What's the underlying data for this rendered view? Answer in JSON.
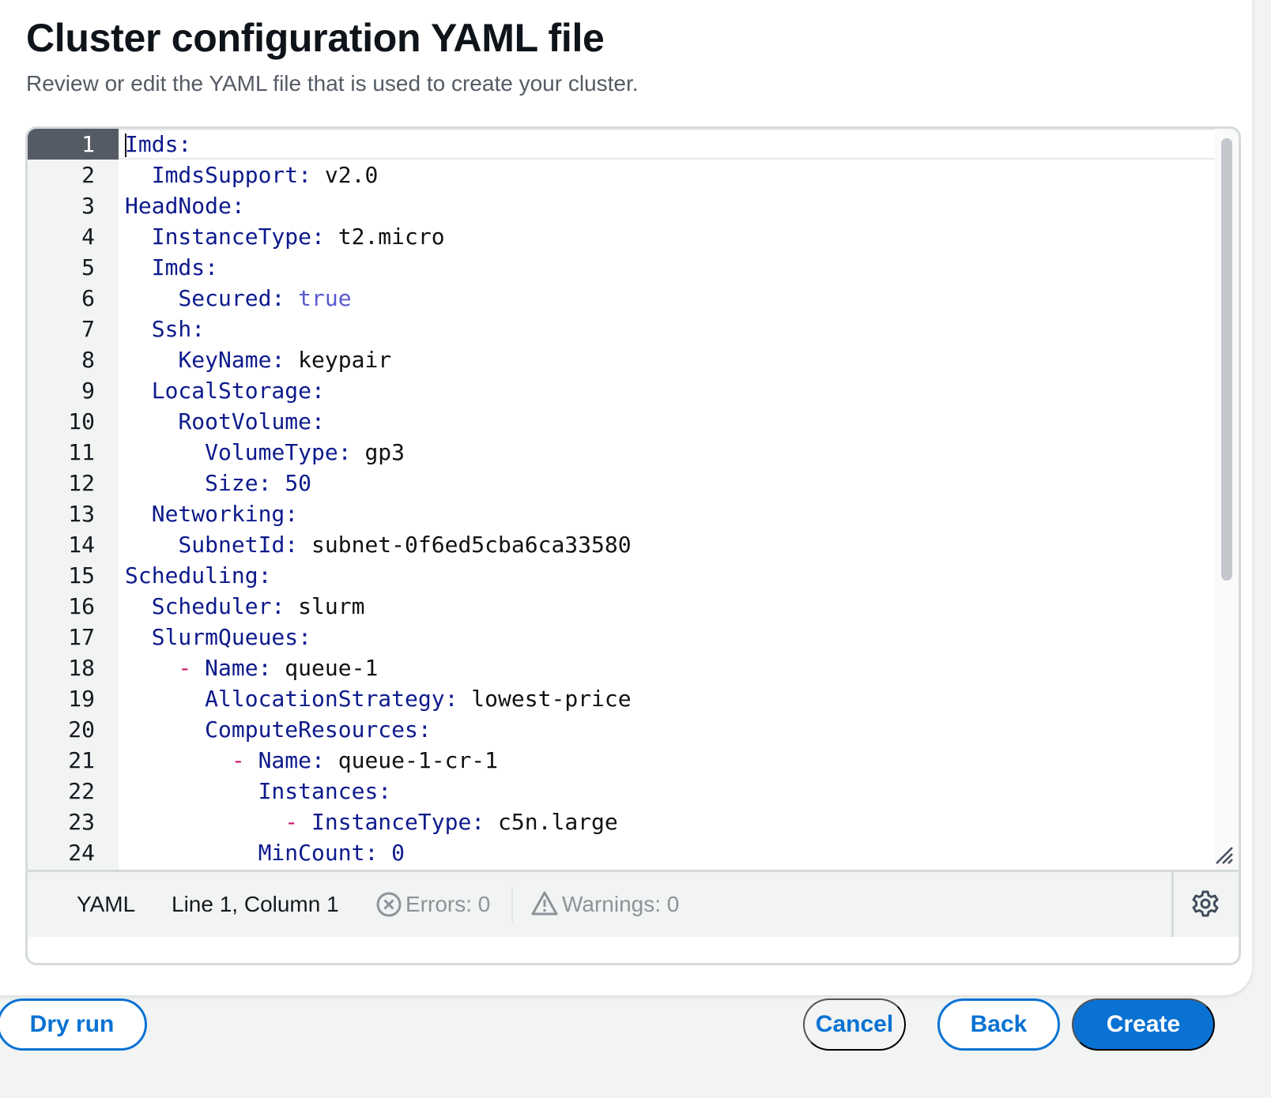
{
  "page": {
    "title": "Cluster configuration YAML file",
    "subtitle": "Review or edit the YAML file that is used to create your cluster."
  },
  "editor": {
    "line_numbers": [
      "1",
      "2",
      "3",
      "4",
      "5",
      "6",
      "7",
      "8",
      "9",
      "10",
      "11",
      "12",
      "13",
      "14",
      "15",
      "16",
      "17",
      "18",
      "19",
      "20",
      "21",
      "22",
      "23",
      "24"
    ],
    "lines": [
      [
        {
          "t": "k",
          "s": "Imds:"
        }
      ],
      [
        {
          "t": "v",
          "s": "  "
        },
        {
          "t": "k",
          "s": "ImdsSupport:"
        },
        {
          "t": "v",
          "s": " v2.0"
        }
      ],
      [
        {
          "t": "k",
          "s": "HeadNode:"
        }
      ],
      [
        {
          "t": "v",
          "s": "  "
        },
        {
          "t": "k",
          "s": "InstanceType:"
        },
        {
          "t": "v",
          "s": " t2.micro"
        }
      ],
      [
        {
          "t": "v",
          "s": "  "
        },
        {
          "t": "k",
          "s": "Imds:"
        }
      ],
      [
        {
          "t": "v",
          "s": "    "
        },
        {
          "t": "k",
          "s": "Secured:"
        },
        {
          "t": "v",
          "s": " "
        },
        {
          "t": "b",
          "s": "true"
        }
      ],
      [
        {
          "t": "v",
          "s": "  "
        },
        {
          "t": "k",
          "s": "Ssh:"
        }
      ],
      [
        {
          "t": "v",
          "s": "    "
        },
        {
          "t": "k",
          "s": "KeyName:"
        },
        {
          "t": "v",
          "s": " keypair"
        }
      ],
      [
        {
          "t": "v",
          "s": "  "
        },
        {
          "t": "k",
          "s": "LocalStorage:"
        }
      ],
      [
        {
          "t": "v",
          "s": "    "
        },
        {
          "t": "k",
          "s": "RootVolume:"
        }
      ],
      [
        {
          "t": "v",
          "s": "      "
        },
        {
          "t": "k",
          "s": "VolumeType:"
        },
        {
          "t": "v",
          "s": " gp3"
        }
      ],
      [
        {
          "t": "v",
          "s": "      "
        },
        {
          "t": "k",
          "s": "Size:"
        },
        {
          "t": "v",
          "s": " "
        },
        {
          "t": "n",
          "s": "50"
        }
      ],
      [
        {
          "t": "v",
          "s": "  "
        },
        {
          "t": "k",
          "s": "Networking:"
        }
      ],
      [
        {
          "t": "v",
          "s": "    "
        },
        {
          "t": "k",
          "s": "SubnetId:"
        },
        {
          "t": "v",
          "s": " subnet-0f6ed5cba6ca33580"
        }
      ],
      [
        {
          "t": "k",
          "s": "Scheduling:"
        }
      ],
      [
        {
          "t": "v",
          "s": "  "
        },
        {
          "t": "k",
          "s": "Scheduler:"
        },
        {
          "t": "v",
          "s": " slurm"
        }
      ],
      [
        {
          "t": "v",
          "s": "  "
        },
        {
          "t": "k",
          "s": "SlurmQueues:"
        }
      ],
      [
        {
          "t": "v",
          "s": "    "
        },
        {
          "t": "d",
          "s": "-"
        },
        {
          "t": "v",
          "s": " "
        },
        {
          "t": "k",
          "s": "Name:"
        },
        {
          "t": "v",
          "s": " queue-1"
        }
      ],
      [
        {
          "t": "v",
          "s": "      "
        },
        {
          "t": "k",
          "s": "AllocationStrategy:"
        },
        {
          "t": "v",
          "s": " lowest-price"
        }
      ],
      [
        {
          "t": "v",
          "s": "      "
        },
        {
          "t": "k",
          "s": "ComputeResources:"
        }
      ],
      [
        {
          "t": "v",
          "s": "        "
        },
        {
          "t": "d",
          "s": "-"
        },
        {
          "t": "v",
          "s": " "
        },
        {
          "t": "k",
          "s": "Name:"
        },
        {
          "t": "v",
          "s": " queue-1-cr-1"
        }
      ],
      [
        {
          "t": "v",
          "s": "          "
        },
        {
          "t": "k",
          "s": "Instances:"
        }
      ],
      [
        {
          "t": "v",
          "s": "            "
        },
        {
          "t": "d",
          "s": "-"
        },
        {
          "t": "v",
          "s": " "
        },
        {
          "t": "k",
          "s": "InstanceType:"
        },
        {
          "t": "v",
          "s": " c5n.large"
        }
      ],
      [
        {
          "t": "v",
          "s": "          "
        },
        {
          "t": "k",
          "s": "MinCount:"
        },
        {
          "t": "v",
          "s": " "
        },
        {
          "t": "n",
          "s": "0"
        }
      ]
    ],
    "active_line": 1,
    "colors": {
      "key": "#0d1a8c",
      "bool": "#5a5ad0",
      "dash": "#c8186b",
      "gutter_active": "#545b64"
    }
  },
  "status_bar": {
    "language": "YAML",
    "position": "Line 1, Column 1",
    "errors": "Errors: 0",
    "warnings": "Warnings: 0",
    "icons": [
      "error-circle-icon",
      "warning-triangle-icon",
      "settings-gear-icon"
    ]
  },
  "actions": {
    "dry_run": "Dry run",
    "cancel": "Cancel",
    "back": "Back",
    "create": "Create",
    "accent": "#0972d3"
  }
}
